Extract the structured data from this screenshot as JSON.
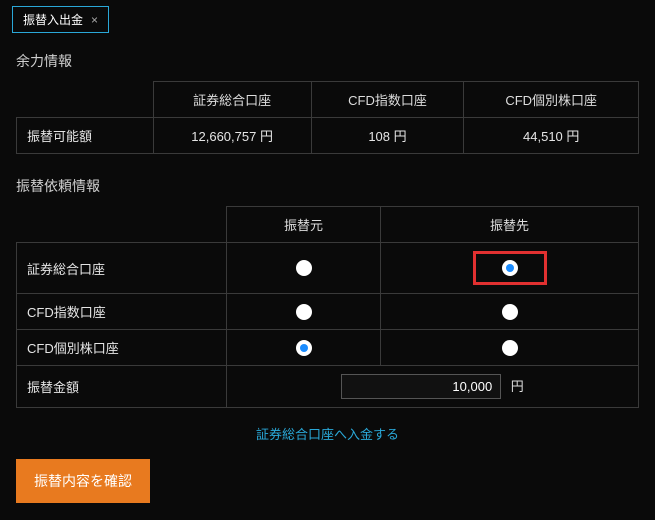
{
  "tab": {
    "label": "振替入出金",
    "close": "×"
  },
  "balance": {
    "title": "余力情報",
    "columns": [
      "証券総合口座",
      "CFD指数口座",
      "CFD個別株口座"
    ],
    "row_label": "振替可能額",
    "values": [
      "12,660,757 円",
      "108 円",
      "44,510 円"
    ]
  },
  "request": {
    "title": "振替依頼情報",
    "columns": [
      "振替元",
      "振替先"
    ],
    "rows": [
      "証券総合口座",
      "CFD指数口座",
      "CFD個別株口座"
    ],
    "amount_label": "振替金額",
    "amount_value": "10,000",
    "amount_unit": "円"
  },
  "link": {
    "deposit": "証券総合口座へ入金する"
  },
  "button": {
    "confirm": "振替内容を確認"
  }
}
